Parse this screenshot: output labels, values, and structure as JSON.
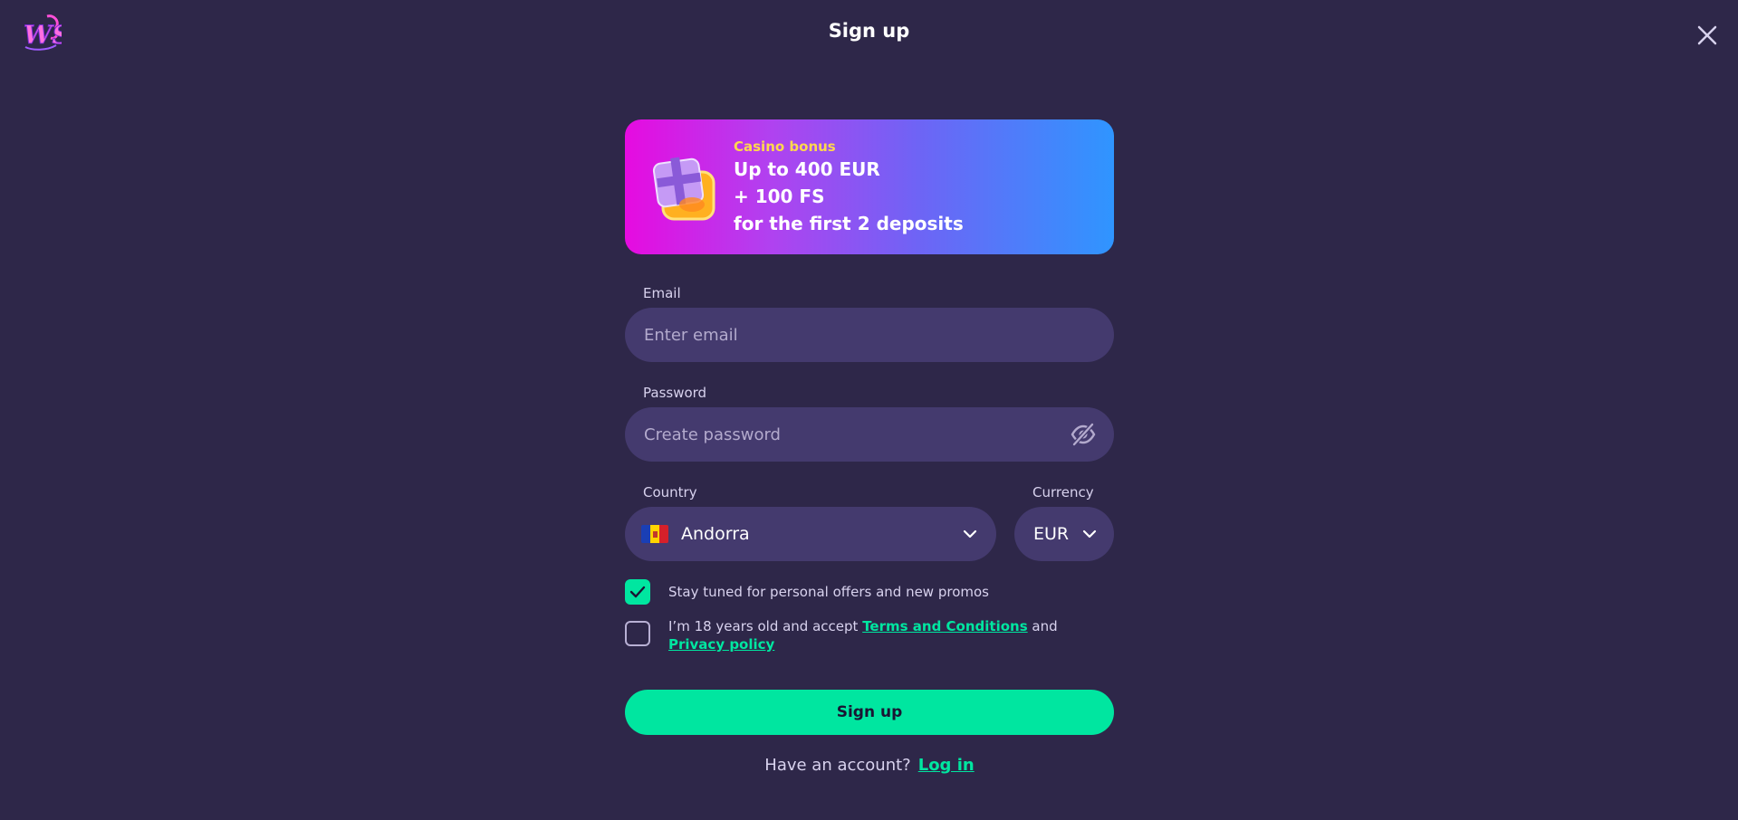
{
  "header": {
    "title": "Sign up",
    "logo_icon": "ws-logo-icon",
    "close_icon": "close-icon"
  },
  "banner": {
    "kicker": "Casino bonus",
    "line1": "Up to 400 EUR",
    "line2": "+ 100 FS",
    "line3": "for the first 2 deposits",
    "art_icon": "gift-box-icon"
  },
  "email": {
    "label": "Email",
    "placeholder": "Enter email",
    "value": ""
  },
  "password": {
    "label": "Password",
    "placeholder": "Create password",
    "value": "",
    "toggle_icon": "eye-slash-icon"
  },
  "country": {
    "label": "Country",
    "selected": "Andorra",
    "flag_icon": "andorra-flag-icon"
  },
  "currency": {
    "label": "Currency",
    "selected": "EUR"
  },
  "consents": {
    "promos": {
      "text": "Stay tuned for personal offers and new promos",
      "checked": true
    },
    "terms": {
      "prefix": "I’m 18 years old and accept ",
      "terms_link": "Terms and Conditions",
      "middle": " and ",
      "privacy_link": "Privacy policy",
      "checked": false
    }
  },
  "submit": {
    "label": "Sign up"
  },
  "footer": {
    "prompt": "Have an account?",
    "login_link": "Log in"
  },
  "colors": {
    "background": "#2e2749",
    "field": "#443a6e",
    "accent": "#00e6a0",
    "banner_start": "#e60be0",
    "banner_end": "#2f95ff",
    "bonus_yellow": "#ffd84d"
  }
}
